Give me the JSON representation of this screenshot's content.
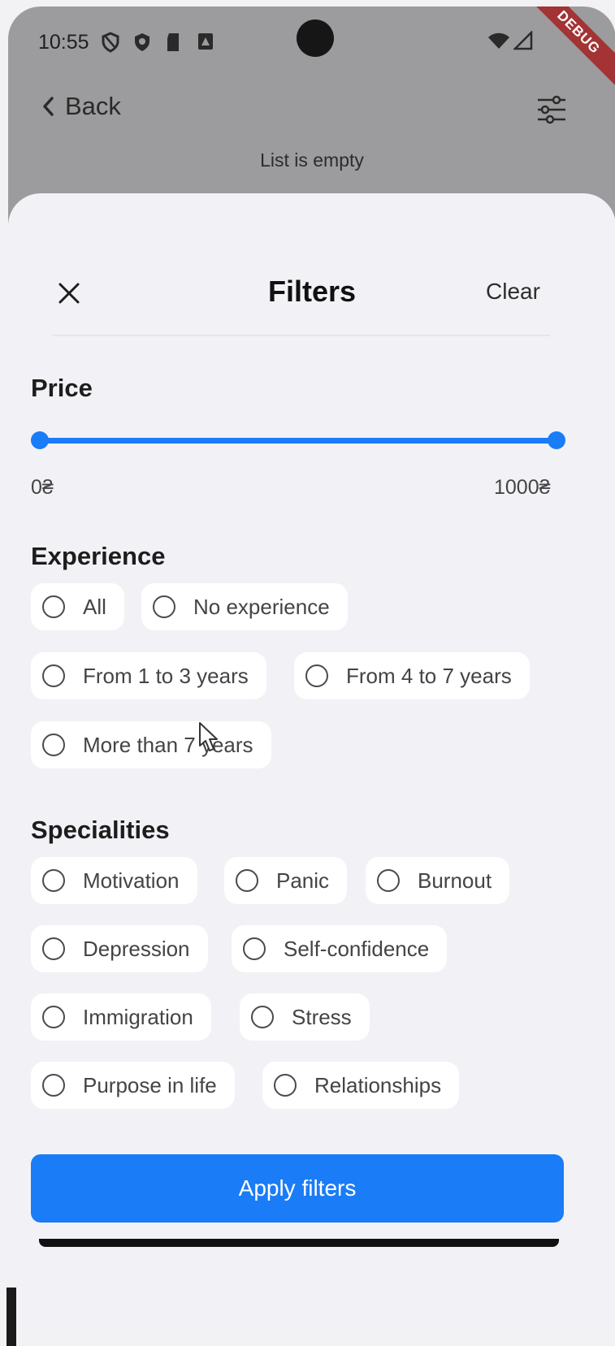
{
  "status_bar": {
    "time": "10:55",
    "debug_label": "DEBUG"
  },
  "app_bar": {
    "back_label": "Back",
    "empty_message": "List is empty"
  },
  "sheet": {
    "title": "Filters",
    "clear_label": "Clear",
    "price": {
      "title": "Price",
      "min_label": "0₴",
      "max_label": "1000₴",
      "range_fraction": [
        0,
        1
      ]
    },
    "experience": {
      "title": "Experience",
      "options": [
        "All",
        "No experience",
        "From 1 to 3 years",
        "From 4 to 7 years",
        "More than 7 years"
      ]
    },
    "specialities": {
      "title": "Specialities",
      "options": [
        "Motivation",
        "Panic",
        "Burnout",
        "Depression",
        "Self-confidence",
        "Immigration",
        "Stress",
        "Purpose in life",
        "Relationships"
      ]
    },
    "apply_label": "Apply filters"
  },
  "colors": {
    "accent": "#1a7cf6",
    "sheet_bg": "#f2f2f6",
    "dim_bg": "#9c9c9e",
    "debug_banner": "#a33334"
  }
}
